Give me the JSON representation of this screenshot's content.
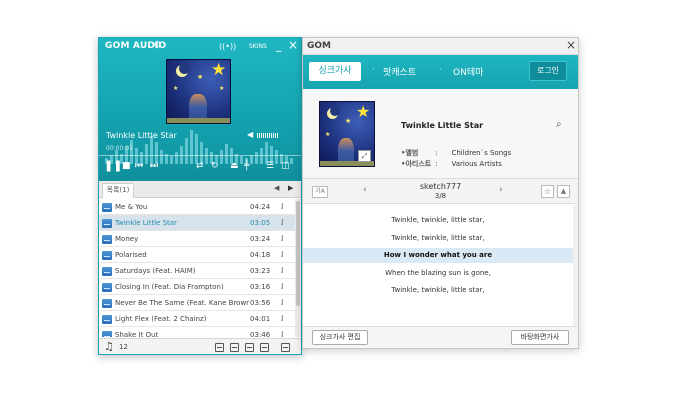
{
  "player": {
    "app_title": "GOM AUDIO",
    "icons": [
      "gear-icon",
      "signal-icon",
      "mini-mode-icon",
      "minimize-icon",
      "close-icon"
    ],
    "skins_label": "SKINS",
    "now_playing": "Twinkle Little Star",
    "time": "00:00:01",
    "playlist_tab": "목록(1)",
    "track_count": "12",
    "colors": {
      "accent": "#18aab5",
      "selected_row": "#d8e2ea",
      "selected_text": "#1f8fb2"
    },
    "tracks": [
      {
        "title": "Me & You",
        "time": "04:24",
        "selected": false
      },
      {
        "title": "Twinkle Little Star",
        "time": "03:05",
        "selected": true
      },
      {
        "title": "Money",
        "time": "03:24",
        "selected": false
      },
      {
        "title": "Polarised",
        "time": "04:18",
        "selected": false
      },
      {
        "title": "Saturdays (Feat. HAIM)",
        "time": "03:23",
        "selected": false
      },
      {
        "title": "Closing In (Feat. Dia Frampton)",
        "time": "03:16",
        "selected": false
      },
      {
        "title": "Never Be The Same (Feat. Kane Brown)",
        "time": "03:56",
        "selected": false
      },
      {
        "title": "Light Flex (Feat. 2 Chainz)",
        "time": "04:01",
        "selected": false
      },
      {
        "title": "Shake It Out",
        "time": "03:46",
        "selected": false
      }
    ],
    "info_glyph": "i"
  },
  "lyrics": {
    "window_title": "GOM",
    "tabs": {
      "sync": "싱크가사",
      "podcast": "팟캐스트",
      "on_theme": "ON테마"
    },
    "login": "로그인",
    "song_title": "Twinkle Little Star",
    "album_label": "•앨범",
    "album_value": "Children`s Songs",
    "artist_label": "•아티스트",
    "artist_value": "Various Artists",
    "separator": ":",
    "author": "sketch777",
    "page": "3/8",
    "lines": [
      {
        "text": "Twinkle, twinkle, little star,",
        "current": false
      },
      {
        "text": "Twinkle, twinkle, little star,",
        "current": false
      },
      {
        "text": "How I wonder what you are",
        "current": true
      },
      {
        "text": "When the blazing sun is gone,",
        "current": false
      },
      {
        "text": "Twinkle, twinkle, little star,",
        "current": false
      }
    ],
    "edit_button": "싱크가사 편집",
    "wallpaper_button": "바탕화면가사"
  }
}
